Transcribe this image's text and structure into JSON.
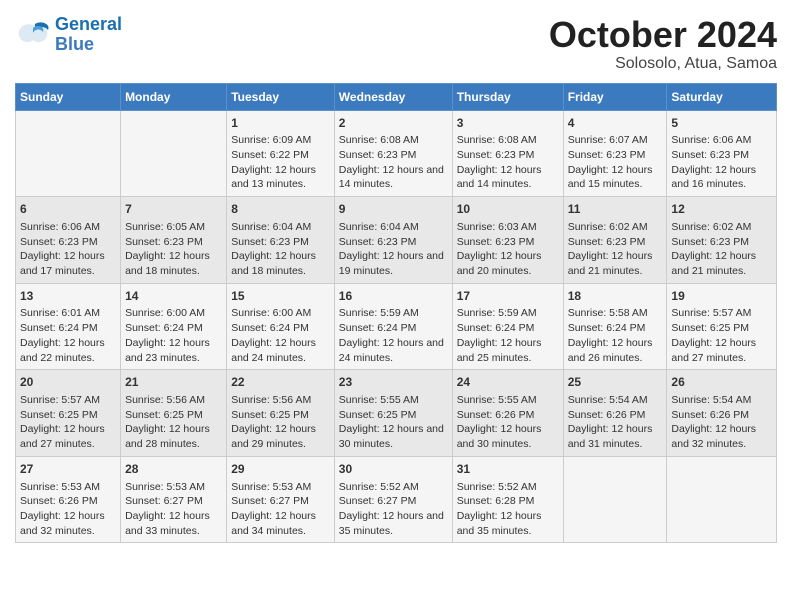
{
  "header": {
    "logo_line1": "General",
    "logo_line2": "Blue",
    "title": "October 2024",
    "subtitle": "Solosolo, Atua, Samoa"
  },
  "weekdays": [
    "Sunday",
    "Monday",
    "Tuesday",
    "Wednesday",
    "Thursday",
    "Friday",
    "Saturday"
  ],
  "weeks": [
    [
      {
        "day": "",
        "content": ""
      },
      {
        "day": "",
        "content": ""
      },
      {
        "day": "1",
        "content": "Sunrise: 6:09 AM\nSunset: 6:22 PM\nDaylight: 12 hours and 13 minutes."
      },
      {
        "day": "2",
        "content": "Sunrise: 6:08 AM\nSunset: 6:23 PM\nDaylight: 12 hours and 14 minutes."
      },
      {
        "day": "3",
        "content": "Sunrise: 6:08 AM\nSunset: 6:23 PM\nDaylight: 12 hours and 14 minutes."
      },
      {
        "day": "4",
        "content": "Sunrise: 6:07 AM\nSunset: 6:23 PM\nDaylight: 12 hours and 15 minutes."
      },
      {
        "day": "5",
        "content": "Sunrise: 6:06 AM\nSunset: 6:23 PM\nDaylight: 12 hours and 16 minutes."
      }
    ],
    [
      {
        "day": "6",
        "content": "Sunrise: 6:06 AM\nSunset: 6:23 PM\nDaylight: 12 hours and 17 minutes."
      },
      {
        "day": "7",
        "content": "Sunrise: 6:05 AM\nSunset: 6:23 PM\nDaylight: 12 hours and 18 minutes."
      },
      {
        "day": "8",
        "content": "Sunrise: 6:04 AM\nSunset: 6:23 PM\nDaylight: 12 hours and 18 minutes."
      },
      {
        "day": "9",
        "content": "Sunrise: 6:04 AM\nSunset: 6:23 PM\nDaylight: 12 hours and 19 minutes."
      },
      {
        "day": "10",
        "content": "Sunrise: 6:03 AM\nSunset: 6:23 PM\nDaylight: 12 hours and 20 minutes."
      },
      {
        "day": "11",
        "content": "Sunrise: 6:02 AM\nSunset: 6:23 PM\nDaylight: 12 hours and 21 minutes."
      },
      {
        "day": "12",
        "content": "Sunrise: 6:02 AM\nSunset: 6:23 PM\nDaylight: 12 hours and 21 minutes."
      }
    ],
    [
      {
        "day": "13",
        "content": "Sunrise: 6:01 AM\nSunset: 6:24 PM\nDaylight: 12 hours and 22 minutes."
      },
      {
        "day": "14",
        "content": "Sunrise: 6:00 AM\nSunset: 6:24 PM\nDaylight: 12 hours and 23 minutes."
      },
      {
        "day": "15",
        "content": "Sunrise: 6:00 AM\nSunset: 6:24 PM\nDaylight: 12 hours and 24 minutes."
      },
      {
        "day": "16",
        "content": "Sunrise: 5:59 AM\nSunset: 6:24 PM\nDaylight: 12 hours and 24 minutes."
      },
      {
        "day": "17",
        "content": "Sunrise: 5:59 AM\nSunset: 6:24 PM\nDaylight: 12 hours and 25 minutes."
      },
      {
        "day": "18",
        "content": "Sunrise: 5:58 AM\nSunset: 6:24 PM\nDaylight: 12 hours and 26 minutes."
      },
      {
        "day": "19",
        "content": "Sunrise: 5:57 AM\nSunset: 6:25 PM\nDaylight: 12 hours and 27 minutes."
      }
    ],
    [
      {
        "day": "20",
        "content": "Sunrise: 5:57 AM\nSunset: 6:25 PM\nDaylight: 12 hours and 27 minutes."
      },
      {
        "day": "21",
        "content": "Sunrise: 5:56 AM\nSunset: 6:25 PM\nDaylight: 12 hours and 28 minutes."
      },
      {
        "day": "22",
        "content": "Sunrise: 5:56 AM\nSunset: 6:25 PM\nDaylight: 12 hours and 29 minutes."
      },
      {
        "day": "23",
        "content": "Sunrise: 5:55 AM\nSunset: 6:25 PM\nDaylight: 12 hours and 30 minutes."
      },
      {
        "day": "24",
        "content": "Sunrise: 5:55 AM\nSunset: 6:26 PM\nDaylight: 12 hours and 30 minutes."
      },
      {
        "day": "25",
        "content": "Sunrise: 5:54 AM\nSunset: 6:26 PM\nDaylight: 12 hours and 31 minutes."
      },
      {
        "day": "26",
        "content": "Sunrise: 5:54 AM\nSunset: 6:26 PM\nDaylight: 12 hours and 32 minutes."
      }
    ],
    [
      {
        "day": "27",
        "content": "Sunrise: 5:53 AM\nSunset: 6:26 PM\nDaylight: 12 hours and 32 minutes."
      },
      {
        "day": "28",
        "content": "Sunrise: 5:53 AM\nSunset: 6:27 PM\nDaylight: 12 hours and 33 minutes."
      },
      {
        "day": "29",
        "content": "Sunrise: 5:53 AM\nSunset: 6:27 PM\nDaylight: 12 hours and 34 minutes."
      },
      {
        "day": "30",
        "content": "Sunrise: 5:52 AM\nSunset: 6:27 PM\nDaylight: 12 hours and 35 minutes."
      },
      {
        "day": "31",
        "content": "Sunrise: 5:52 AM\nSunset: 6:28 PM\nDaylight: 12 hours and 35 minutes."
      },
      {
        "day": "",
        "content": ""
      },
      {
        "day": "",
        "content": ""
      }
    ]
  ]
}
